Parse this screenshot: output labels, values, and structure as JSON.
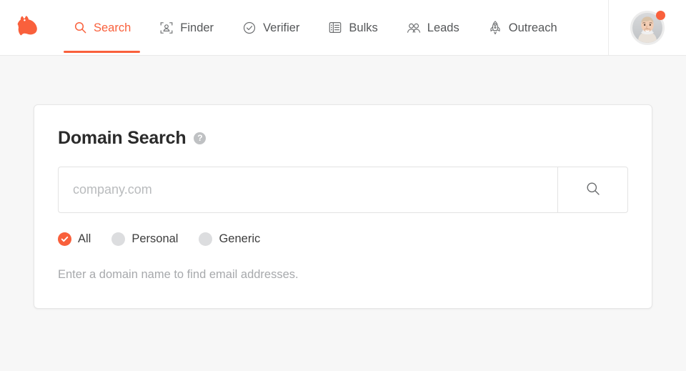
{
  "brand": {
    "logo_icon": "bloodhound-logo-icon",
    "color": "#f9603c"
  },
  "nav": {
    "items": [
      {
        "label": "Search",
        "icon": "search-icon",
        "active": true
      },
      {
        "label": "Finder",
        "icon": "person-scan-icon",
        "active": false
      },
      {
        "label": "Verifier",
        "icon": "check-circle-icon",
        "active": false
      },
      {
        "label": "Bulks",
        "icon": "list-icon",
        "active": false
      },
      {
        "label": "Leads",
        "icon": "people-icon",
        "active": false
      },
      {
        "label": "Outreach",
        "icon": "rocket-icon",
        "active": false
      }
    ]
  },
  "account": {
    "avatar_icon": "avatar",
    "notification_dot": true,
    "dot_color": "#f9603c"
  },
  "card": {
    "title": "Domain Search",
    "help_icon": "question-mark-icon",
    "help_glyph": "?",
    "search": {
      "value": "",
      "placeholder": "company.com",
      "button_icon": "search-icon"
    },
    "filters": [
      {
        "label": "All",
        "selected": true
      },
      {
        "label": "Personal",
        "selected": false
      },
      {
        "label": "Generic",
        "selected": false
      }
    ],
    "hint": "Enter a domain name to find email addresses."
  },
  "colors": {
    "accent": "#f9603c",
    "page_bg": "#f7f7f7",
    "card_bg": "#ffffff",
    "muted_text": "#a7a9ac"
  }
}
